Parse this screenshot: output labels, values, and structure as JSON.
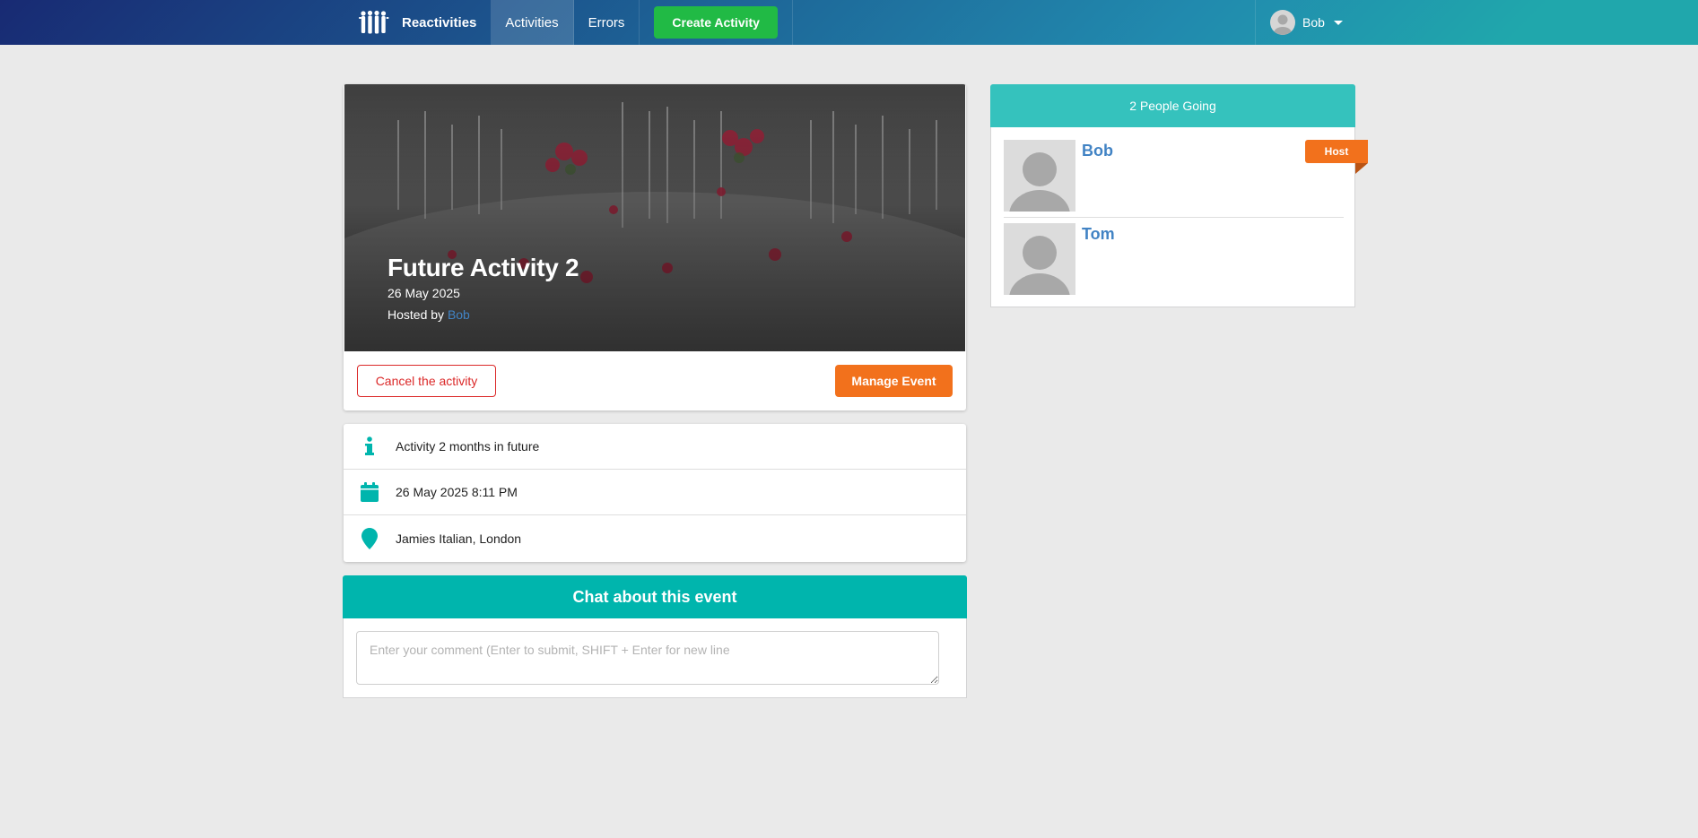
{
  "navbar": {
    "brand": "Reactivities",
    "links": [
      "Activities",
      "Errors"
    ],
    "create_label": "Create Activity",
    "user_name": "Bob"
  },
  "activity": {
    "title": "Future Activity 2",
    "date": "26 May 2025",
    "hosted_prefix": "Hosted by ",
    "host": "Bob",
    "cancel_label": "Cancel the activity",
    "manage_label": "Manage Event",
    "description": "Activity 2 months in future",
    "datetime": "26 May 2025 8:11 PM",
    "location": "Jamies Italian, London"
  },
  "chat": {
    "title": "Chat about this event",
    "placeholder": "Enter your comment (Enter to submit, SHIFT + Enter for new line"
  },
  "attendees": {
    "header": "2 People Going",
    "host_badge": "Host",
    "list": [
      {
        "name": "Bob"
      },
      {
        "name": "Tom"
      }
    ]
  },
  "colors": {
    "teal": "#00b5ad",
    "orange": "#f2711c",
    "green": "#21ba45",
    "red": "#db2828",
    "link": "#4183c4"
  }
}
